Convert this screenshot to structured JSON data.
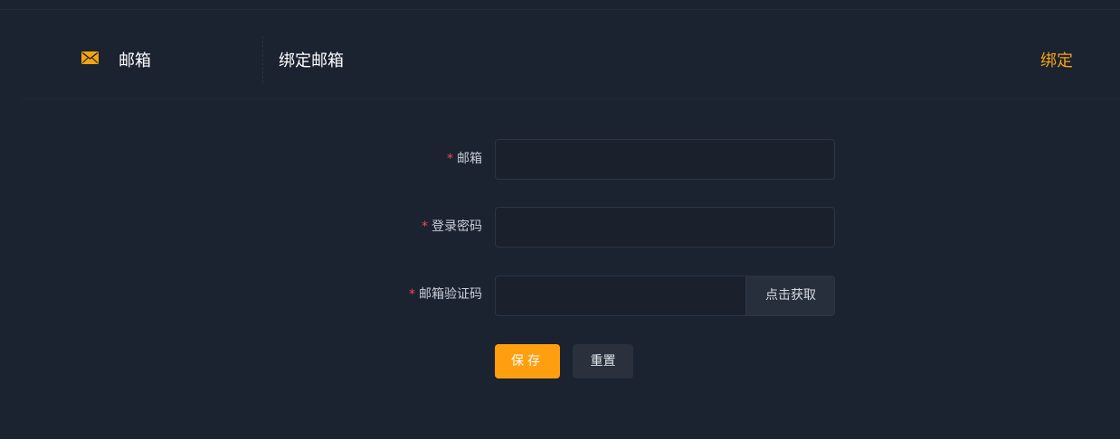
{
  "binding_row": {
    "icon": "mail-icon",
    "label": "邮箱",
    "description": "绑定邮箱",
    "action": "绑定"
  },
  "form": {
    "email": {
      "label": "邮箱",
      "value": ""
    },
    "password": {
      "label": "登录密码",
      "value": ""
    },
    "code": {
      "label": "邮箱验证码",
      "value": "",
      "button": "点击获取"
    },
    "required_mark": "*",
    "save": "保存",
    "reset": "重置"
  },
  "colors": {
    "background": "#1b2230",
    "accent": "#ff9f10",
    "link": "#f5a30f",
    "required": "#f04d4d"
  }
}
